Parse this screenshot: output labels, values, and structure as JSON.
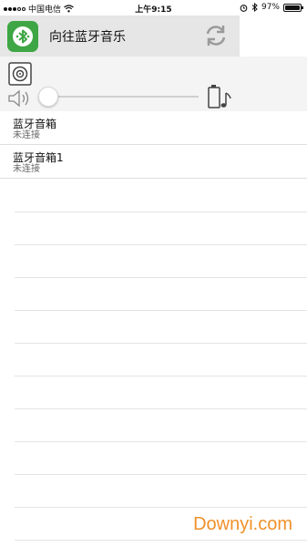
{
  "status_bar": {
    "carrier": "中国电信",
    "time": "上午9:15",
    "battery_percent": "97%",
    "battery_level": 0.97
  },
  "header": {
    "app_icon": "bluetooth-app-icon",
    "title": "向往蓝牙音乐",
    "refresh_icon": "refresh-icon"
  },
  "controls": {
    "speaker_icon": "speaker-box-icon",
    "volume_icon": "volume-icon",
    "volume_level": 0.0,
    "battery_music_icon": "battery-music-icon"
  },
  "devices": [
    {
      "name": "蓝牙音箱",
      "status": "未连接"
    },
    {
      "name": "蓝牙音箱1",
      "status": "未连接"
    }
  ],
  "watermark": "Downyi.com",
  "colors": {
    "app_icon_green": "#3ea644",
    "header_bg": "#e6e6e6",
    "watermark": "#f0902a"
  }
}
